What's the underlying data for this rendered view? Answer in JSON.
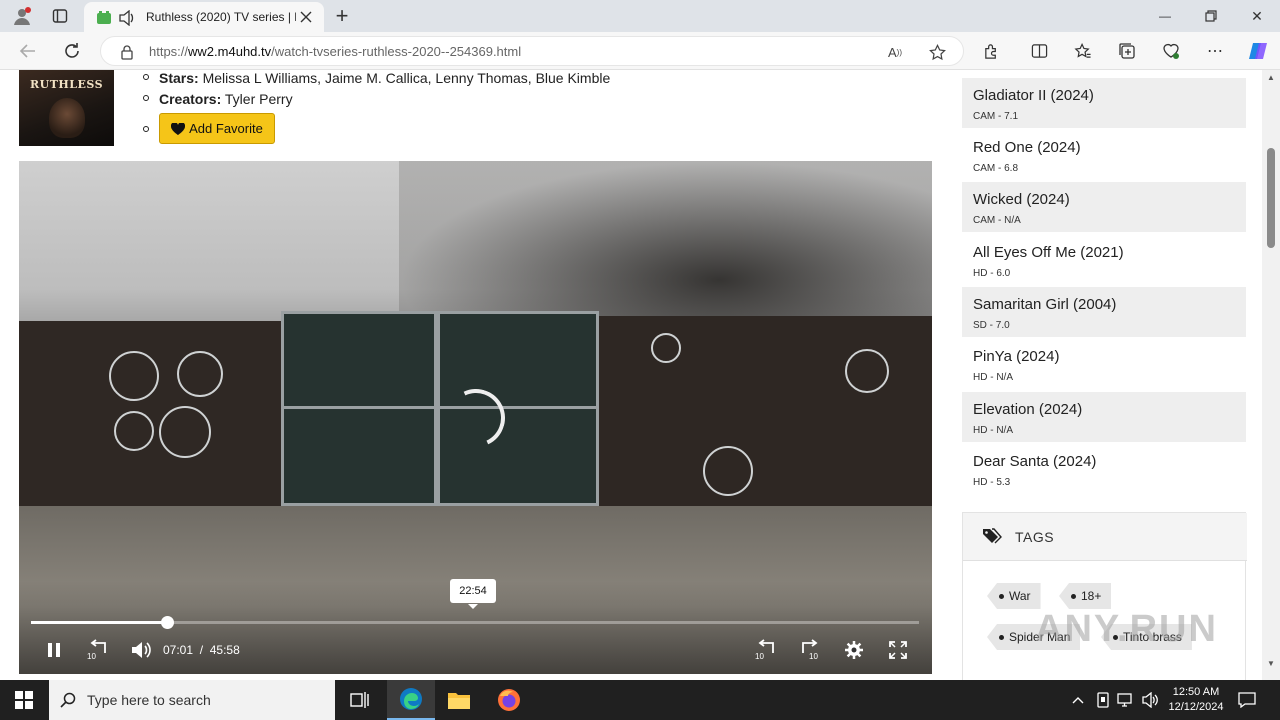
{
  "browser": {
    "tab_title": "Ruthless (2020) TV series | M",
    "url_prefix": "https://",
    "url_host": "ww2.m4uhd.tv",
    "url_path": "/watch-tvseries-ruthless-2020--254369.html",
    "new_tab_symbol": "+",
    "minimize_symbol": "—",
    "close_symbol": "✕"
  },
  "info": {
    "poster_title": "RUTHLESS",
    "stars_label": "Stars:",
    "stars_value": "Melissa L Williams, Jaime M. Callica, Lenny Thomas, Blue Kimble",
    "creators_label": "Creators:",
    "creators_value": "Tyler Perry",
    "favorite_label": "Add Favorite"
  },
  "player": {
    "current_time": "07:01",
    "separator": "/",
    "duration": "45:58",
    "hover_time": "22:54",
    "progress_fraction": 0.153,
    "rewind_label": "10",
    "forward_label": "10"
  },
  "sidebar": {
    "movies": [
      {
        "title": "Gladiator II (2024)",
        "meta": "CAM - 7.1"
      },
      {
        "title": "Red One (2024)",
        "meta": "CAM - 6.8"
      },
      {
        "title": "Wicked (2024)",
        "meta": "CAM - N/A"
      },
      {
        "title": "All Eyes Off Me (2021)",
        "meta": "HD - 6.0"
      },
      {
        "title": "Samaritan Girl (2004)",
        "meta": "SD - 7.0"
      },
      {
        "title": "PinYa (2024)",
        "meta": "HD - N/A"
      },
      {
        "title": "Elevation (2024)",
        "meta": "HD - N/A"
      },
      {
        "title": "Dear Santa (2024)",
        "meta": "HD - 5.3"
      }
    ],
    "tags_heading": "TAGS",
    "tags": [
      "War",
      "18+",
      "Spider Man",
      "Tinto brass"
    ]
  },
  "watermark": "ANY.RUN",
  "taskbar": {
    "search_placeholder": "Type here to search",
    "time": "12:50 AM",
    "date": "12/12/2024"
  },
  "colors": {
    "accent_button": "#f5c518",
    "taskbar": "#202020"
  }
}
